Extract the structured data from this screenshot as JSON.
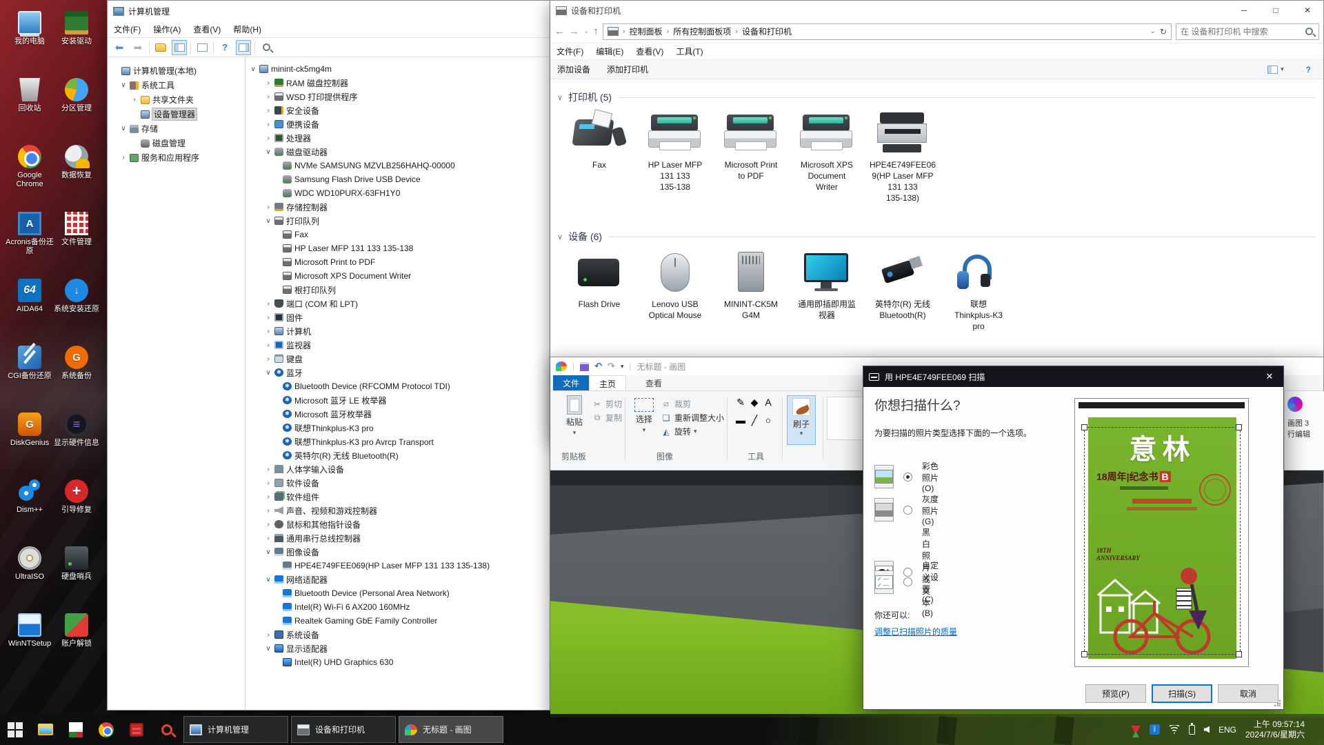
{
  "colors": {
    "accent": "#0078d7",
    "paint_tab_blue": "#0f6cbd",
    "canvas_green": "#79b41e",
    "magazine_green": "#74b02a",
    "dialog_titlebar": "#14141c",
    "link_blue": "#0066cc",
    "taskbar": "#0e0f11"
  },
  "desktop": {
    "col1": [
      {
        "icon": "dk-mycomputer",
        "glyph": "",
        "label": "我的电脑"
      },
      {
        "icon": "dk-recycle",
        "glyph": "",
        "label": "回收站"
      },
      {
        "icon": "dk-chrome",
        "glyph": "",
        "label": "Google Chrome"
      },
      {
        "icon": "dk-acronis",
        "glyph": "A",
        "label": "Acronis备份还原"
      },
      {
        "icon": "dk-aida64",
        "glyph": "64",
        "label": "AIDA64"
      },
      {
        "icon": "dk-cgi",
        "glyph": "",
        "label": "CGI备份还原"
      },
      {
        "icon": "dk-diskgenius",
        "glyph": "G",
        "label": "DiskGenius"
      },
      {
        "icon": "dk-dism",
        "glyph": "",
        "label": "Dism++"
      },
      {
        "icon": "dk-ultraiso",
        "glyph": "",
        "label": "UltraISO"
      },
      {
        "icon": "dk-winntsetup",
        "glyph": "",
        "label": "WinNTSetup"
      }
    ],
    "col2": [
      {
        "icon": "dk-driver",
        "glyph": "",
        "label": "安装驱动"
      },
      {
        "icon": "dk-partition",
        "glyph": "",
        "label": "分区管理"
      },
      {
        "icon": "dk-recover",
        "glyph": "",
        "label": "数据恢复"
      },
      {
        "icon": "dk-filemgr",
        "glyph": "",
        "label": "文件管理"
      },
      {
        "icon": "dk-sysinstall",
        "glyph": "↓",
        "label": "系统安装还原"
      },
      {
        "icon": "dk-sysbackup",
        "glyph": "G",
        "label": "系统备份"
      },
      {
        "icon": "dk-hwinfo",
        "glyph": "≡",
        "label": "显示硬件信息"
      },
      {
        "icon": "dk-bootfix",
        "glyph": "+",
        "label": "引导修复"
      },
      {
        "icon": "dk-sentinel",
        "glyph": "",
        "label": "硬盘哨兵"
      },
      {
        "icon": "dk-unlock",
        "glyph": "",
        "label": "账户解锁"
      }
    ]
  },
  "cm": {
    "title": "计算机管理",
    "menus": [
      "文件(F)",
      "操作(A)",
      "查看(V)",
      "帮助(H)"
    ],
    "toolbar_icons": [
      "back-icon",
      "forward-icon",
      "export-icon",
      "console-tree-toggle-icon",
      "properties-icon",
      "help-icon",
      "action-pane-toggle-icon",
      "device-search-icon"
    ],
    "tree": [
      {
        "cls": "lv0",
        "exp": "",
        "icon": "ic-computer",
        "label": "计算机管理(本地)"
      },
      {
        "cls": "lv1",
        "exp": "∨",
        "icon": "ic-tools",
        "label": "系统工具"
      },
      {
        "cls": "lv2",
        "exp": "›",
        "icon": "ic-shared-folder",
        "label": "共享文件夹"
      },
      {
        "cls": "lv2 sel",
        "exp": "",
        "icon": "ic-device-manager",
        "label": "设备管理器"
      },
      {
        "cls": "lv1",
        "exp": "∨",
        "icon": "ic-storage",
        "label": "存储"
      },
      {
        "cls": "lv2",
        "exp": "",
        "icon": "ic-disk-management",
        "label": "磁盘管理"
      },
      {
        "cls": "lv1",
        "exp": "›",
        "icon": "ic-services",
        "label": "服务和应用程序"
      }
    ],
    "devices": [
      {
        "cls": "lv0",
        "exp": "∨",
        "icon": "ic-computer",
        "label": "minint-ck5mg4m"
      },
      {
        "cls": "lv1",
        "exp": "›",
        "icon": "ic-memory",
        "label": "RAM 磁盘控制器"
      },
      {
        "cls": "lv1",
        "exp": "›",
        "icon": "ic-printer",
        "label": "WSD 打印提供程序"
      },
      {
        "cls": "lv1",
        "exp": "›",
        "icon": "ic-security",
        "label": "安全设备"
      },
      {
        "cls": "lv1",
        "exp": "›",
        "icon": "ic-portable",
        "label": "便携设备"
      },
      {
        "cls": "lv1",
        "exp": "›",
        "icon": "ic-processor",
        "label": "处理器"
      },
      {
        "cls": "lv1",
        "exp": "∨",
        "icon": "ic-disk",
        "label": "磁盘驱动器"
      },
      {
        "cls": "lv2",
        "exp": "",
        "icon": "ic-disk",
        "label": "NVMe SAMSUNG MZVLB256HAHQ-00000"
      },
      {
        "cls": "lv2",
        "exp": "",
        "icon": "ic-disk",
        "label": "Samsung Flash Drive USB Device"
      },
      {
        "cls": "lv2",
        "exp": "",
        "icon": "ic-disk",
        "label": "WDC WD10PURX-63FH1Y0"
      },
      {
        "cls": "lv1",
        "exp": "›",
        "icon": "ic-storage-controller",
        "label": "存储控制器"
      },
      {
        "cls": "lv1",
        "exp": "∨",
        "icon": "ic-printer",
        "label": "打印队列"
      },
      {
        "cls": "lv2",
        "exp": "",
        "icon": "ic-printer",
        "label": "Fax"
      },
      {
        "cls": "lv2",
        "exp": "",
        "icon": "ic-printer",
        "label": "HP Laser MFP 131 133 135-138"
      },
      {
        "cls": "lv2",
        "exp": "",
        "icon": "ic-printer",
        "label": "Microsoft Print to PDF"
      },
      {
        "cls": "lv2",
        "exp": "",
        "icon": "ic-printer",
        "label": "Microsoft XPS Document Writer"
      },
      {
        "cls": "lv2",
        "exp": "",
        "icon": "ic-printer",
        "label": "根打印队列"
      },
      {
        "cls": "lv1",
        "exp": "›",
        "icon": "ic-port",
        "label": "端口 (COM 和 LPT)"
      },
      {
        "cls": "lv1",
        "exp": "›",
        "icon": "ic-firmware",
        "label": "固件"
      },
      {
        "cls": "lv1",
        "exp": "›",
        "icon": "ic-computer",
        "label": "计算机"
      },
      {
        "cls": "lv1",
        "exp": "›",
        "icon": "ic-monitor",
        "label": "监视器"
      },
      {
        "cls": "lv1",
        "exp": "›",
        "icon": "ic-keyboard",
        "label": "键盘"
      },
      {
        "cls": "lv1",
        "exp": "∨",
        "icon": "ic-bluetooth",
        "label": "蓝牙"
      },
      {
        "cls": "lv2",
        "exp": "",
        "icon": "ic-bluetooth",
        "label": "Bluetooth Device (RFCOMM Protocol TDI)"
      },
      {
        "cls": "lv2",
        "exp": "",
        "icon": "ic-bluetooth",
        "label": "Microsoft 蓝牙 LE 枚举器"
      },
      {
        "cls": "lv2",
        "exp": "",
        "icon": "ic-bluetooth",
        "label": "Microsoft 蓝牙枚举器"
      },
      {
        "cls": "lv2",
        "exp": "",
        "icon": "ic-bluetooth",
        "label": "联想Thinkplus-K3 pro"
      },
      {
        "cls": "lv2",
        "exp": "",
        "icon": "ic-bluetooth",
        "label": "联想Thinkplus-K3 pro Avrcp Transport"
      },
      {
        "cls": "lv2",
        "exp": "",
        "icon": "ic-bluetooth",
        "label": "英特尔(R) 无线 Bluetooth(R)"
      },
      {
        "cls": "lv1",
        "exp": "›",
        "icon": "ic-hid",
        "label": "人体学输入设备"
      },
      {
        "cls": "lv1",
        "exp": "›",
        "icon": "ic-software",
        "label": "软件设备"
      },
      {
        "cls": "lv1",
        "exp": "›",
        "icon": "ic-software-component",
        "label": "软件组件"
      },
      {
        "cls": "lv1",
        "exp": "›",
        "icon": "ic-audio",
        "label": "声音、视频和游戏控制器"
      },
      {
        "cls": "lv1",
        "exp": "›",
        "icon": "ic-mouse",
        "label": "鼠标和其他指针设备"
      },
      {
        "cls": "lv1",
        "exp": "›",
        "icon": "ic-usb",
        "label": "通用串行总线控制器"
      },
      {
        "cls": "lv1",
        "exp": "∨",
        "icon": "ic-imaging",
        "label": "图像设备"
      },
      {
        "cls": "lv2",
        "exp": "",
        "icon": "ic-imaging",
        "label": "HPE4E749FEE069(HP Laser MFP 131 133 135-138)"
      },
      {
        "cls": "lv1",
        "exp": "∨",
        "icon": "ic-network",
        "label": "网络适配器"
      },
      {
        "cls": "lv2",
        "exp": "",
        "icon": "ic-network",
        "label": "Bluetooth Device (Personal Area Network)"
      },
      {
        "cls": "lv2",
        "exp": "",
        "icon": "ic-network",
        "label": "Intel(R) Wi-Fi 6 AX200 160MHz"
      },
      {
        "cls": "lv2",
        "exp": "",
        "icon": "ic-network",
        "label": "Realtek Gaming GbE Family Controller"
      },
      {
        "cls": "lv1",
        "exp": "›",
        "icon": "ic-system",
        "label": "系统设备"
      },
      {
        "cls": "lv1",
        "exp": "∨",
        "icon": "ic-display",
        "label": "显示适配器"
      },
      {
        "cls": "lv2",
        "exp": "",
        "icon": "ic-display",
        "label": "Intel(R) UHD Graphics 630"
      }
    ]
  },
  "dp": {
    "title": "设备和打印机",
    "window_controls": {
      "minimize": "─",
      "maximize": "□",
      "close": "✕"
    },
    "breadcrumb": [
      "控制面板",
      "所有控制面板项",
      "设备和打印机"
    ],
    "search_placeholder": "在 设备和打印机 中搜索",
    "menus": [
      "文件(F)",
      "编辑(E)",
      "查看(V)",
      "工具(T)"
    ],
    "toolbar": {
      "add_device": "添加设备",
      "add_printer": "添加打印机"
    },
    "toolbar_icons": [
      "view-options-icon",
      "help-icon"
    ],
    "printers_header": "打印机 (5)",
    "devices_header": "设备 (6)",
    "printers": [
      {
        "icon": "pic-fax",
        "label": "Fax"
      },
      {
        "icon": "pic-printer",
        "label": "HP Laser MFP\n131 133\n135-138"
      },
      {
        "icon": "pic-printer",
        "label": "Microsoft Print\nto PDF"
      },
      {
        "icon": "pic-printer",
        "label": "Microsoft XPS\nDocument\nWriter"
      },
      {
        "icon": "pic-mfp",
        "label": "HPE4E749FEE06\n9(HP Laser MFP\n131 133\n135-138)"
      }
    ],
    "devices": [
      {
        "icon": "dev-drive",
        "label": "Flash Drive"
      },
      {
        "icon": "dev-mouse",
        "label": "Lenovo USB\nOptical Mouse"
      },
      {
        "icon": "dev-tower",
        "label": "MININT-CK5M\nG4M"
      },
      {
        "icon": "dev-monitor",
        "label": "通用即插即用监\n视器"
      },
      {
        "icon": "dev-dongle",
        "label": "英特尔(R) 无线\nBluetooth(R)"
      },
      {
        "icon": "dev-headset",
        "label": "联想\nThinkplus-K3\npro"
      }
    ]
  },
  "paint": {
    "title": "无标题 - 画图",
    "qat_icons": [
      "paint-app-icon",
      "save-icon",
      "undo-icon",
      "redo-icon",
      "customize-qat-icon"
    ],
    "tabs": [
      "文件",
      "主页",
      "查看"
    ],
    "clipboard": {
      "group": "剪贴板",
      "paste": "粘贴",
      "cut": "剪切",
      "copy": "复制"
    },
    "image": {
      "group": "图像",
      "select": "选择",
      "crop": "裁剪",
      "resize": "重新调整大小",
      "rotate": "旋转"
    },
    "tools_group": "工具",
    "tools": [
      {
        "icon": "pencil-icon",
        "g": "✎",
        "c": "#b8860b"
      },
      {
        "icon": "fill-icon",
        "g": "◆",
        "c": "#2a9d8f"
      },
      {
        "icon": "text-icon",
        "g": "A",
        "c": "#1f3864"
      },
      {
        "icon": "eraser-icon",
        "g": "▬",
        "c": "#e493a8"
      },
      {
        "icon": "color-picker-icon",
        "g": "╱",
        "c": "#3a6ea5"
      },
      {
        "icon": "magnifier-icon",
        "g": "○",
        "c": "#8a6d3b"
      }
    ],
    "brush": "刷子",
    "shapes": [
      "╲",
      "∿",
      "○",
      "△",
      "◇",
      "▷",
      "⇩",
      "✳",
      "☆"
    ],
    "paint3d_line1": "画图 3",
    "paint3d_line2": "行编辑"
  },
  "scan": {
    "title": "用 HPE4E749FEE069 扫描",
    "close": "✕",
    "heading": "你想扫描什么?",
    "subheading": "为要扫描的照片类型选择下面的一个选项。",
    "options": [
      {
        "thumb": "th-color",
        "state": "on",
        "label": "彩色照片(O)"
      },
      {
        "thumb": "th-gray",
        "state": "",
        "label": "灰度照片(G)"
      },
      {
        "thumb": "th-bw",
        "state": "",
        "label": "黑白照片或文本(B)"
      },
      {
        "thumb": "th-custom",
        "state": "",
        "label": "自定义设置(C)"
      }
    ],
    "more": "你还可以:",
    "link": "调整已扫描照片的质量",
    "buttons": {
      "preview": "预览(P)",
      "scan": "扫描(S)",
      "cancel": "取消"
    },
    "magazine": {
      "masthead": "意林",
      "subtitle": "18周年|纪念书",
      "subtitle_badge": "B",
      "anniversary": "18TH\nANNIVERSARY"
    }
  },
  "taskbar": {
    "launcher_icons": [
      "start-icon",
      "file-explorer-icon",
      "document-app-icon",
      "chrome-icon",
      "red-app-icon",
      "search-icon"
    ],
    "windows": [
      {
        "icon": "tb-cm",
        "cls": "",
        "label": "计算机管理"
      },
      {
        "icon": "tb-dp",
        "cls": "",
        "label": "设备和打印机"
      },
      {
        "icon": "tb-paint",
        "cls": "active",
        "label": "无标题 - 画图"
      }
    ],
    "tray_icons": [
      "gpu-tray-icon",
      "bluetooth-icon",
      "wifi-icon",
      "usb-device-icon",
      "volume-icon"
    ],
    "lang": "ENG",
    "time": "上午 09:57:14",
    "date": "2024/7/6/星期六"
  }
}
